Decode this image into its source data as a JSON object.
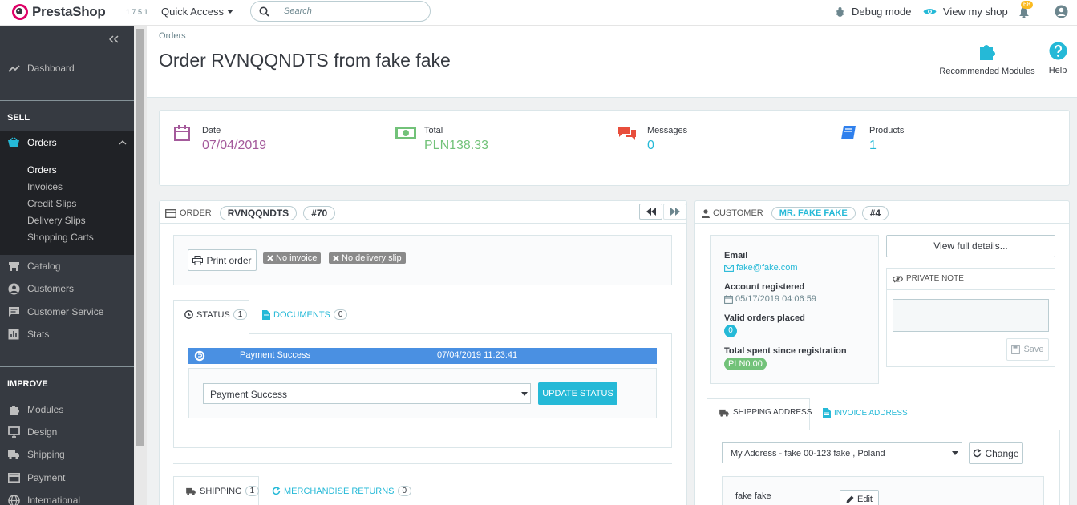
{
  "header": {
    "brand": "PrestaShop",
    "version": "1.7.5.1",
    "quick_access": "Quick Access",
    "search_placeholder": "Search",
    "debug_mode": "Debug mode",
    "view_shop": "View my shop",
    "notification_count": "68"
  },
  "sidebar": {
    "dashboard": "Dashboard",
    "sell_title": "SELL",
    "orders": "Orders",
    "orders_sub": [
      "Orders",
      "Invoices",
      "Credit Slips",
      "Delivery Slips",
      "Shopping Carts"
    ],
    "catalog": "Catalog",
    "customers": "Customers",
    "customer_service": "Customer Service",
    "stats": "Stats",
    "improve_title": "IMPROVE",
    "modules": "Modules",
    "design": "Design",
    "shipping": "Shipping",
    "payment": "Payment",
    "international": "International"
  },
  "page": {
    "breadcrumb": "Orders",
    "title": "Order RVNQQNDTS from fake fake",
    "recommended_modules": "Recommended Modules",
    "help": "Help"
  },
  "kpis": {
    "date_label": "Date",
    "date_value": "07/04/2019",
    "total_label": "Total",
    "total_value": "PLN138.33",
    "messages_label": "Messages",
    "messages_value": "0",
    "products_label": "Products",
    "products_value": "1"
  },
  "order_panel": {
    "heading": "ORDER",
    "reference": "RVNQQNDTS",
    "id": "#70",
    "print_order": "Print order",
    "no_invoice": "No invoice",
    "no_delivery_slip": "No delivery slip",
    "tab_status": "STATUS",
    "tab_status_count": "1",
    "tab_documents": "DOCUMENTS",
    "tab_documents_count": "0",
    "status_row": {
      "status": "Payment Success",
      "date": "07/04/2019 11:23:41"
    },
    "status_select": "Payment Success",
    "update_status": "UPDATE STATUS",
    "tab_shipping": "SHIPPING",
    "tab_shipping_count": "1",
    "tab_returns": "MERCHANDISE RETURNS",
    "tab_returns_count": "0"
  },
  "customer_panel": {
    "heading": "CUSTOMER",
    "name": "MR. FAKE FAKE",
    "id": "#4",
    "email_label": "Email",
    "email": "fake@fake.com",
    "registered_label": "Account registered",
    "registered": "05/17/2019 04:06:59",
    "valid_orders_label": "Valid orders placed",
    "valid_orders": "0",
    "spent_label": "Total spent since registration",
    "spent": "PLN0.00",
    "view_details": "View full details...",
    "private_note": "PRIVATE NOTE",
    "save": "Save",
    "tab_shipping_address": "SHIPPING ADDRESS",
    "tab_invoice_address": "INVOICE ADDRESS",
    "address_select": "My Address - fake 00-123 fake , Poland",
    "change": "Change",
    "address_name": "fake fake",
    "edit": "Edit"
  },
  "colors": {
    "accent": "#25b9d7",
    "sidebar": "#363a41",
    "status_row": "#4a90e2",
    "success": "#72c279",
    "date_purple": "#a45a9b"
  }
}
